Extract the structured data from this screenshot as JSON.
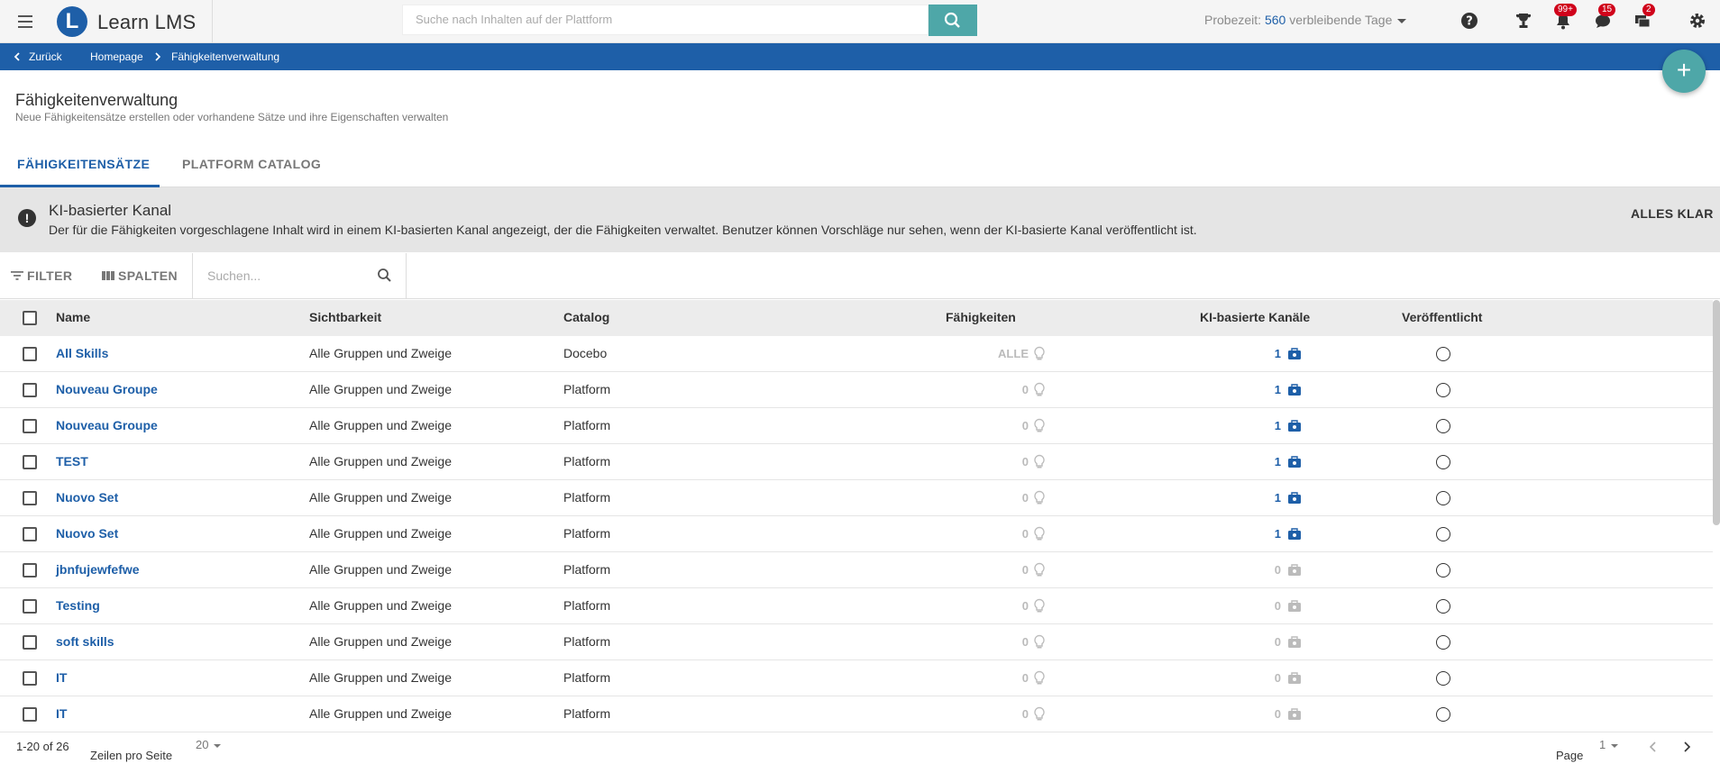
{
  "app": {
    "title": "Learn LMS",
    "logo_letter": "L"
  },
  "top_search": {
    "placeholder": "Suche nach Inhalten auf der Plattform"
  },
  "trial": {
    "label": "Probezeit:",
    "days": "560",
    "suffix": "verbleibende Tage"
  },
  "notifications": {
    "bell_badge": "99+",
    "chat_badge": "15",
    "msg_badge": "2"
  },
  "breadcrumb": {
    "back": "Zurück",
    "home": "Homepage",
    "current": "Fähigkeitenverwaltung"
  },
  "page": {
    "title": "Fähigkeitenverwaltung",
    "subtitle": "Neue Fähigkeitensätze erstellen oder vorhandene Sätze und ihre Eigenschaften verwalten"
  },
  "tabs": [
    {
      "label": "FÄHIGKEITENSÄTZE"
    },
    {
      "label": "PLATFORM CATALOG"
    }
  ],
  "banner": {
    "title": "KI-basierter Kanal",
    "text": "Der für die Fähigkeiten vorgeschlagene Inhalt wird in einem KI-basierten Kanal angezeigt, der die Fähigkeiten verwaltet. Benutzer können Vorschläge nur sehen, wenn der KI-basierte Kanal veröffentlicht ist.",
    "button": "ALLES KLAR"
  },
  "toolbar": {
    "filter": "FILTER",
    "columns": "SPALTEN",
    "search_placeholder": "Suchen..."
  },
  "table": {
    "headers": {
      "name": "Name",
      "visibility": "Sichtbarkeit",
      "catalog": "Catalog",
      "skills": "Fähigkeiten",
      "channels": "KI-basierte Kanäle",
      "published": "Veröffentlicht"
    },
    "rows": [
      {
        "name": "All Skills",
        "visibility": "Alle Gruppen und Zweige",
        "catalog": "Docebo",
        "skills": "ALLE",
        "channels": "1"
      },
      {
        "name": "Nouveau Groupe",
        "visibility": "Alle Gruppen und Zweige",
        "catalog": "Platform",
        "skills": "0",
        "channels": "1"
      },
      {
        "name": "Nouveau Groupe",
        "visibility": "Alle Gruppen und Zweige",
        "catalog": "Platform",
        "skills": "0",
        "channels": "1"
      },
      {
        "name": "TEST",
        "visibility": "Alle Gruppen und Zweige",
        "catalog": "Platform",
        "skills": "0",
        "channels": "1"
      },
      {
        "name": "Nuovo Set",
        "visibility": "Alle Gruppen und Zweige",
        "catalog": "Platform",
        "skills": "0",
        "channels": "1"
      },
      {
        "name": "Nuovo Set",
        "visibility": "Alle Gruppen und Zweige",
        "catalog": "Platform",
        "skills": "0",
        "channels": "1"
      },
      {
        "name": "jbnfujewfefwe",
        "visibility": "Alle Gruppen und Zweige",
        "catalog": "Platform",
        "skills": "0",
        "channels": "0"
      },
      {
        "name": "Testing",
        "visibility": "Alle Gruppen und Zweige",
        "catalog": "Platform",
        "skills": "0",
        "channels": "0"
      },
      {
        "name": "soft skills",
        "visibility": "Alle Gruppen und Zweige",
        "catalog": "Platform",
        "skills": "0",
        "channels": "0"
      },
      {
        "name": "IT",
        "visibility": "Alle Gruppen und Zweige",
        "catalog": "Platform",
        "skills": "0",
        "channels": "0"
      },
      {
        "name": "IT",
        "visibility": "Alle Gruppen und Zweige",
        "catalog": "Platform",
        "skills": "0",
        "channels": "0"
      }
    ]
  },
  "footer": {
    "range": "1-20 of 26",
    "rows_per_page_label": "Zeilen pro Seite",
    "rows_per_page": "20",
    "page_label": "Page",
    "page": "1"
  },
  "colors": {
    "brand": "#1e5fa8",
    "accent": "#4ea7a8",
    "badge": "#d0021b"
  }
}
